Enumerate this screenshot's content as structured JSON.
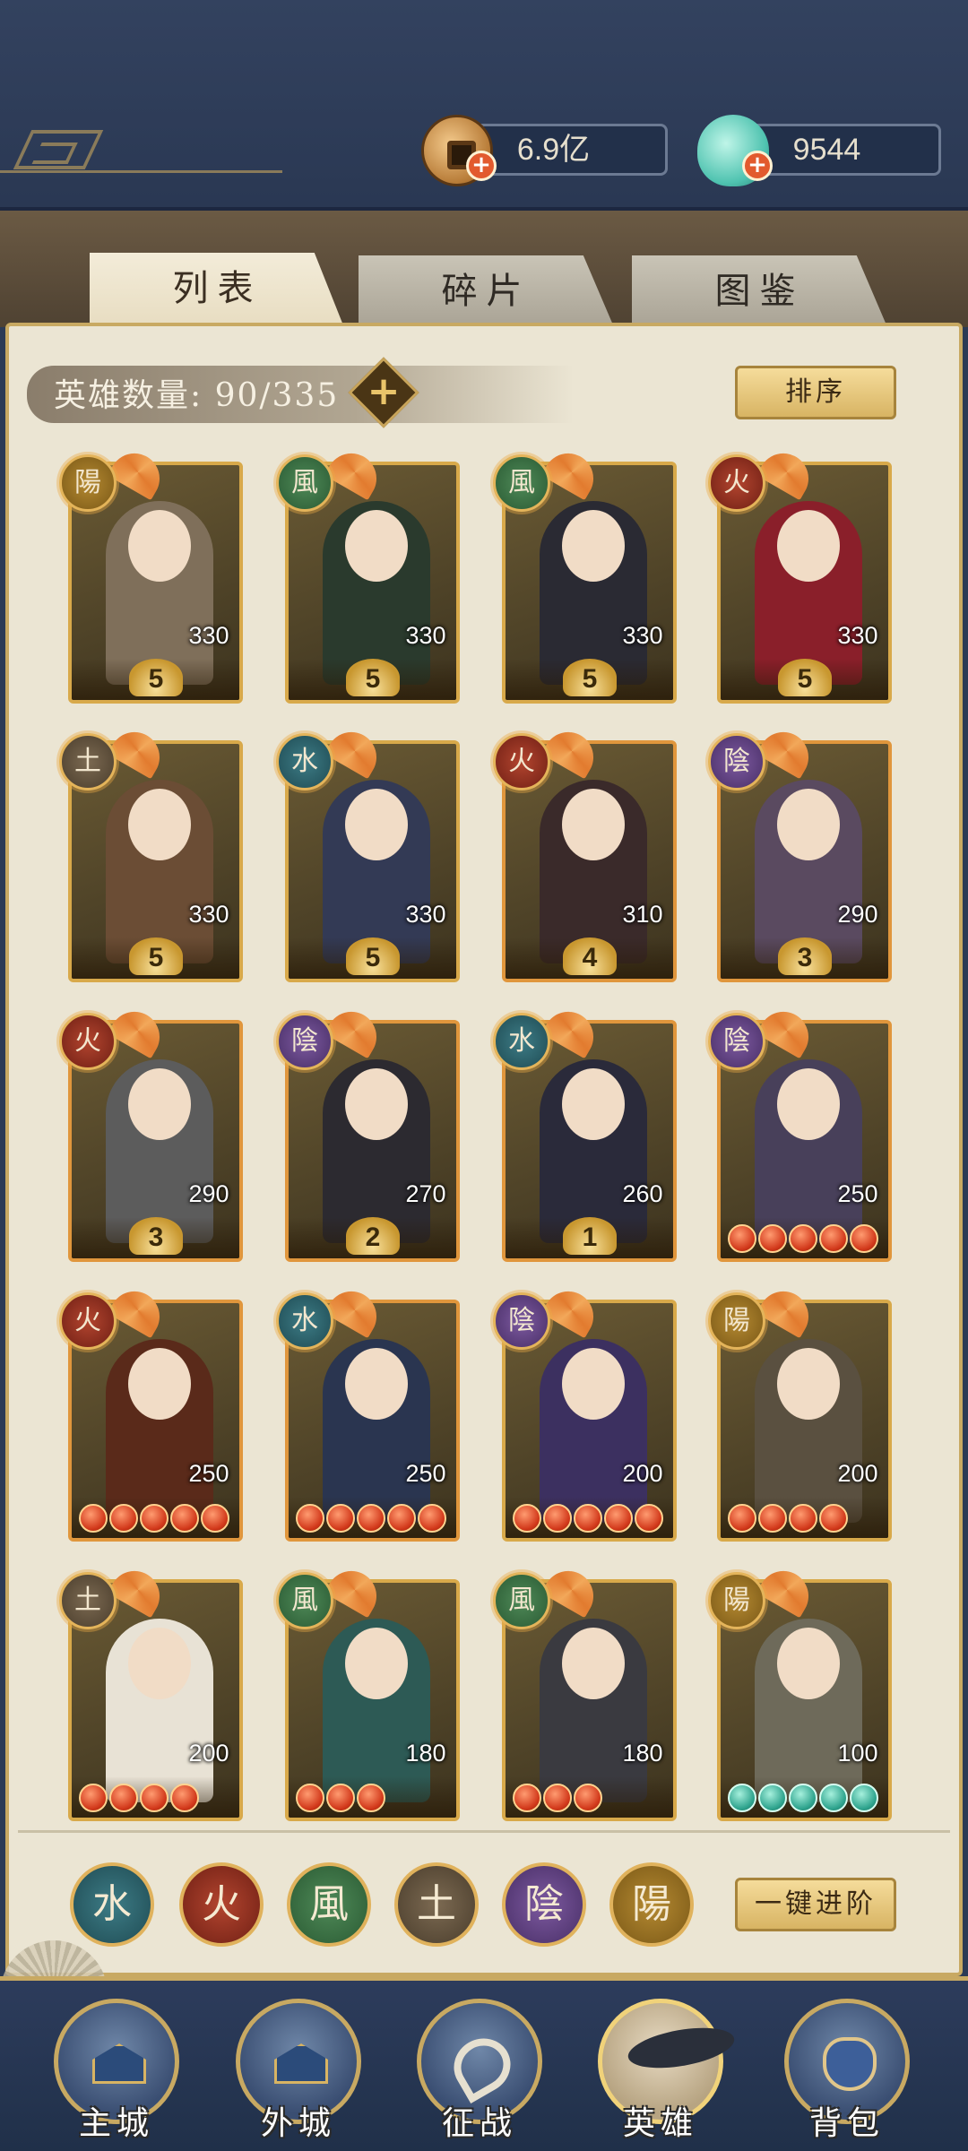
{
  "currencies": {
    "coin": {
      "amount": "6.9亿",
      "icon": "copper-coin-icon"
    },
    "jade": {
      "amount": "9544",
      "icon": "jade-gem-icon"
    }
  },
  "tabs": [
    {
      "label": "列表",
      "active": true
    },
    {
      "label": "碎片",
      "active": false
    },
    {
      "label": "图鉴",
      "active": false
    }
  ],
  "hero_count": {
    "label": "英雄数量:",
    "value": "90/335"
  },
  "buttons": {
    "sort": "排序",
    "advance": "一键进阶"
  },
  "elements": {
    "yang": "陽",
    "wind": "風",
    "fire": "火",
    "earth": "土",
    "water": "水",
    "yin": "陰"
  },
  "colors": {
    "frame_gold": "#d8a94a",
    "frame_orange": "#e0963c",
    "panel_bg": "#ebe5d3",
    "nav_bg": "#2d3c5c"
  },
  "heroes": [
    {
      "element": "陽",
      "level": "330",
      "stars": "5",
      "orbs": 0
    },
    {
      "element": "風",
      "level": "330",
      "stars": "5",
      "orbs": 0
    },
    {
      "element": "風",
      "level": "330",
      "stars": "5",
      "orbs": 0
    },
    {
      "element": "火",
      "level": "330",
      "stars": "5",
      "orbs": 0
    },
    {
      "element": "土",
      "level": "330",
      "stars": "5",
      "orbs": 0
    },
    {
      "element": "水",
      "level": "330",
      "stars": "5",
      "orbs": 0
    },
    {
      "element": "火",
      "level": "310",
      "stars": "4",
      "orbs": 0
    },
    {
      "element": "陰",
      "level": "290",
      "stars": "3",
      "orbs": 0
    },
    {
      "element": "火",
      "level": "290",
      "stars": "3",
      "orbs": 0
    },
    {
      "element": "陰",
      "level": "270",
      "stars": "2",
      "orbs": 0
    },
    {
      "element": "水",
      "level": "260",
      "stars": "1",
      "orbs": 0
    },
    {
      "element": "陰",
      "level": "250",
      "stars": "",
      "orbs": 5
    },
    {
      "element": "火",
      "level": "250",
      "stars": "",
      "orbs": 5
    },
    {
      "element": "水",
      "level": "250",
      "stars": "",
      "orbs": 5
    },
    {
      "element": "陰",
      "level": "200",
      "stars": "",
      "orbs": 5
    },
    {
      "element": "陽",
      "level": "200",
      "stars": "",
      "orbs": 4
    },
    {
      "element": "土",
      "level": "200",
      "stars": "",
      "orbs": 4
    },
    {
      "element": "風",
      "level": "180",
      "stars": "",
      "orbs": 3
    },
    {
      "element": "風",
      "level": "180",
      "stars": "",
      "orbs": 3
    },
    {
      "element": "陽",
      "level": "100",
      "stars": "",
      "orbs": 5,
      "orb_color": "teal"
    }
  ],
  "filters": [
    "水",
    "火",
    "風",
    "土",
    "陰",
    "陽"
  ],
  "nav": [
    {
      "label": "主城",
      "icon": "main-city-icon",
      "active": false
    },
    {
      "label": "外城",
      "icon": "outer-city-icon",
      "active": false
    },
    {
      "label": "征战",
      "icon": "battle-horn-icon",
      "active": false
    },
    {
      "label": "英雄",
      "icon": "hero-portrait-icon",
      "active": true
    },
    {
      "label": "背包",
      "icon": "backpack-icon",
      "active": false
    }
  ]
}
